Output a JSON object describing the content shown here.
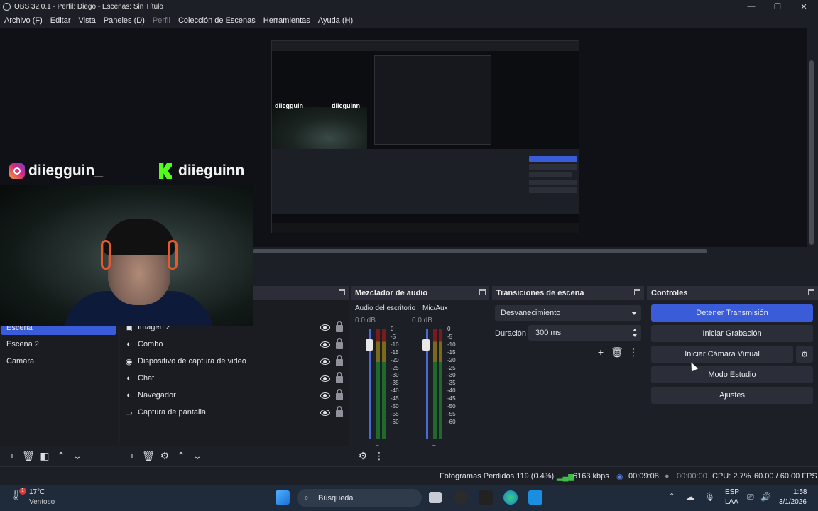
{
  "window": {
    "title": "OBS 32.0.1 - Perfil: Diego - Escenas: Sin Título",
    "controls": [
      "—",
      "❐",
      "✕"
    ]
  },
  "menu": {
    "items": [
      "Archivo (F)",
      "Editar",
      "Vista",
      "Paneles (D)",
      "Perfil",
      "Colección de Escenas",
      "Herramientas",
      "Ayuda (H)"
    ]
  },
  "preview": {
    "overlay_instagram": "diiegguin_",
    "overlay_kick": "diieguinn",
    "capture_instagram": "diiegguin",
    "capture_kick": "diieguinn"
  },
  "scenes": {
    "items": [
      "Escena",
      "Escena 2",
      "Camara"
    ],
    "selected": "Escena"
  },
  "sources": {
    "items": [
      "Imagen 2",
      "Combo",
      "Dispositivo de captura de video",
      "Chat",
      "Navegador",
      "Captura de pantalla"
    ]
  },
  "mixer": {
    "title": "Mezclador de audio",
    "channels": [
      {
        "name": "Audio del escritorio",
        "db": "0.0 dB",
        "level": 0.85
      },
      {
        "name": "Mic/Aux",
        "db": "0.0 dB",
        "level": 0.85
      }
    ],
    "scale": [
      "0",
      "-5",
      "-10",
      "-15",
      "-20",
      "-25",
      "-30",
      "-35",
      "-40",
      "-45",
      "-50",
      "-55",
      "-60"
    ]
  },
  "transitions": {
    "title": "Transiciones de escena",
    "selected": "Desvanecimiento",
    "duration_label": "Duración",
    "duration_value": "300 ms"
  },
  "controls": {
    "title": "Controles",
    "stop_stream": "Detener Transmisión",
    "start_recording": "Iniciar Grabación",
    "start_virtual_cam": "Iniciar Cámara Virtual",
    "studio_mode": "Modo Estudio",
    "settings": "Ajustes"
  },
  "status": {
    "dropped_frames": "Fotogramas Perdidos 119 (0.4%)",
    "bitrate": "6163 kbps",
    "stream_time": "00:09:08",
    "rec_time": "00:00:00",
    "cpu": "CPU: 2.7%",
    "fps": "60.00 / 60.00 FPS"
  },
  "taskbar": {
    "weather_temp": "17°C",
    "weather_desc": "Ventoso",
    "weather_badge": "1",
    "search_placeholder": "Búsqueda",
    "lang_top": "ESP",
    "lang_bottom": "LAA",
    "time": "1:58",
    "date": "3/1/2026"
  },
  "colors": {
    "accent": "#3a5cd8",
    "panel_bg": "#1d1f26",
    "header_bg": "#2b2e38"
  }
}
